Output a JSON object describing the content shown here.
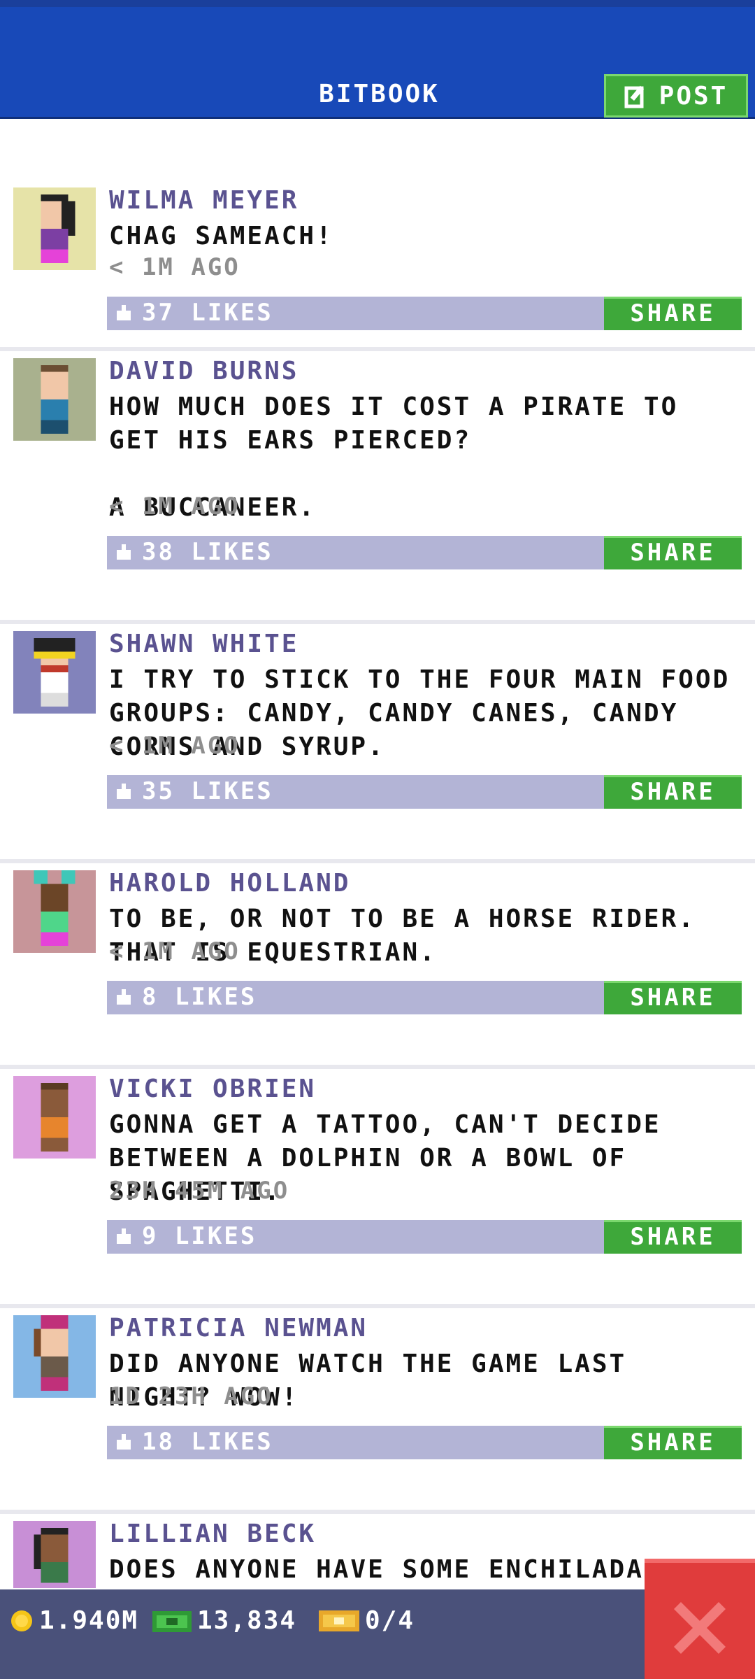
{
  "header": {
    "title": "BITBOOK",
    "post_label": "POST"
  },
  "posts": [
    {
      "name": "WILMA MEYER",
      "text": "CHAG SAMEACH!",
      "time": "< 1M AGO",
      "likes": "37 LIKES",
      "share": "SHARE",
      "avatar_bg": "#e6e3a8"
    },
    {
      "name": "DAVID BURNS",
      "text": "HOW MUCH DOES IT COST A PIRATE TO GET HIS EARS PIERCED?\n\nA BUCCANEER.",
      "time": "< 1M AGO",
      "likes": "38 LIKES",
      "share": "SHARE",
      "avatar_bg": "#a9b18e"
    },
    {
      "name": "SHAWN WHITE",
      "text": "I TRY TO STICK TO THE FOUR MAIN FOOD GROUPS: CANDY, CANDY CANES, CANDY CORNS AND SYRUP.",
      "time": "< 1M AGO",
      "likes": "35 LIKES",
      "share": "SHARE",
      "avatar_bg": "#8283bb"
    },
    {
      "name": "HAROLD HOLLAND",
      "text": "TO BE, OR NOT TO BE A HORSE RIDER. THAT IS EQUESTRIAN.",
      "time": "< 1M AGO",
      "likes": "8 LIKES",
      "share": "SHARE",
      "avatar_bg": "#c79599"
    },
    {
      "name": "VICKI OBRIEN",
      "text": "GONNA GET A TATTOO, CAN'T DECIDE BETWEEN A DOLPHIN OR A BOWL OF SPAGHETTI.",
      "time": "23H 45M AGO",
      "likes": "9 LIKES",
      "share": "SHARE",
      "avatar_bg": "#dd9ede"
    },
    {
      "name": "PATRICIA NEWMAN",
      "text": "DID ANYONE WATCH THE GAME LAST NIGHT? WOW!",
      "time": "1D 23H AGO",
      "likes": "18 LIKES",
      "share": "SHARE",
      "avatar_bg": "#84b7e6"
    },
    {
      "name": "LILLIAN BECK",
      "text": "DOES ANYONE HAVE SOME ENCHILADA",
      "time": "",
      "likes": "",
      "share": "",
      "avatar_bg": "#c88fd6"
    }
  ],
  "status": {
    "coins": "1.940M",
    "bux": "13,834",
    "tickets": "0/4"
  },
  "colors": {
    "header": "#1849b8",
    "share_green": "#3ea83a",
    "like_bar": "#b3b4d6",
    "name_purple": "#5a5290",
    "close_red": "#e03c3c"
  },
  "icons": {
    "post": "edit-icon",
    "like": "thumbs-up-icon",
    "coin": "coin-icon",
    "bux": "cash-icon",
    "ticket": "ticket-icon",
    "close": "close-icon"
  }
}
